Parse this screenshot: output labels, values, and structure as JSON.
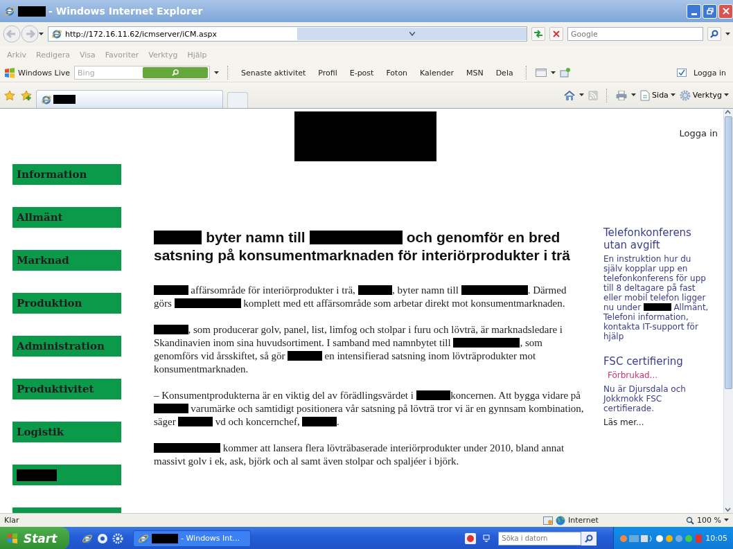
{
  "window": {
    "title": "- Windows Internet Explorer"
  },
  "address_bar": {
    "url": "http://172.16.11.62/icmserver/iCM.aspx",
    "search_placeholder": "Google"
  },
  "menu": [
    "Arkiv",
    "Redigera",
    "Visa",
    "Favoriter",
    "Verktyg",
    "Hjälp"
  ],
  "live_toolbar": {
    "brand": "Windows Live",
    "search_placeholder": "Bing",
    "links": [
      "Senaste aktivitet",
      "Profil",
      "E-post",
      "Foton",
      "Kalender",
      "MSN",
      "Dela"
    ],
    "sign_in": "Logga in"
  },
  "command_bar": {
    "page": "Sida",
    "tools": "Verktyg"
  },
  "page": {
    "sign_in": "Logga in",
    "nav": [
      {
        "kind": "link",
        "label": "Information"
      },
      {
        "kind": "link",
        "label": "Allmänt"
      },
      {
        "kind": "link",
        "label": "Marknad"
      },
      {
        "kind": "link",
        "label": "Produktion"
      },
      {
        "kind": "link",
        "label": "Administration"
      },
      {
        "kind": "link",
        "label": "Produktivitet"
      },
      {
        "kind": "link",
        "label": "Logistik"
      },
      {
        "kind": "redacted"
      },
      {
        "kind": "cut"
      }
    ],
    "article": {
      "heading": [
        {
          "kind": "redaction"
        },
        {
          "kind": "text",
          "text": " byter namn till "
        },
        {
          "kind": "longredaction"
        },
        {
          "kind": "text",
          "text": " och genomför en bred satsning på konsumentmarknaden för interiörprodukter i trä"
        }
      ],
      "paragraphs": [
        [
          {
            "kind": "redaction"
          },
          {
            "kind": "text",
            "text": " affärsområde för interiörprodukter i trä, "
          },
          {
            "kind": "redaction"
          },
          {
            "kind": "text",
            "text": ", byter namn till "
          },
          {
            "kind": "longredaction"
          },
          {
            "kind": "text",
            "text": ". Därmed görs "
          },
          {
            "kind": "longredaction"
          },
          {
            "kind": "text",
            "text": " komplett med ett affärsområde som arbetar direkt mot konsumentmarknaden."
          }
        ],
        [
          {
            "kind": "redaction"
          },
          {
            "kind": "text",
            "text": ", som producerar golv, panel, list, limfog och stolpar i furu och lövträ, är marknadsledare i Skandinavien inom sina huvudsortiment. I samband med namnbytet till "
          },
          {
            "kind": "longredaction"
          },
          {
            "kind": "text",
            "text": ", som genomförs vid årsskiftet, så gör "
          },
          {
            "kind": "redaction"
          },
          {
            "kind": "text",
            "text": " en intensifierad satsning inom lövträprodukter mot konsumentmarknaden."
          }
        ],
        [
          {
            "kind": "text",
            "text": "– Konsumentprodukterna är en viktig del av förädlingsvärdet i "
          },
          {
            "kind": "redaction"
          },
          {
            "kind": "text",
            "text": "koncernen. Att bygga vidare på "
          },
          {
            "kind": "redaction"
          },
          {
            "kind": "text",
            "text": " varumärke och samtidigt positionera vår satsning på lövträ tror vi är en gynnsam kombination, säger "
          },
          {
            "kind": "redaction"
          },
          {
            "kind": "text",
            "text": " vd och koncernchef, "
          },
          {
            "kind": "redaction"
          },
          {
            "kind": "text",
            "text": "."
          }
        ],
        [
          {
            "kind": "longredaction"
          },
          {
            "kind": "text",
            "text": " kommer att lansera flera lövträbaserade interiörprodukter under 2010, bland annat massivt golv i ek, ask, björk och al samt även stolpar och spaljéer i björk."
          }
        ]
      ]
    },
    "news": [
      {
        "title": "Telefonkonferens utan avgift",
        "body": [
          {
            "kind": "text",
            "text": "En instruktion hur du själv kopplar upp en telefonkonferens för upp till 8 deltagare på fast eller mobil telefon ligger nu under "
          },
          {
            "kind": "redaction"
          },
          {
            "kind": "text",
            "text": " Allmänt, Telefoni information, kontakta IT-support för hjälp"
          }
        ]
      },
      {
        "title": "FSC certifiering",
        "status": "Förbrukad...",
        "body": [
          {
            "kind": "text",
            "text": "Nu är Djursdala och Jokkmokk FSC certifierade."
          }
        ],
        "link": "Läs mer..."
      }
    ]
  },
  "status_bar": {
    "status": "Klar",
    "zone": "Internet",
    "zoom": "100 %"
  },
  "taskbar": {
    "start": "Start",
    "tasks": [
      {
        "label": "- Windows Int..."
      }
    ],
    "search_placeholder": "Söka i datorn",
    "clock": "10:05"
  }
}
